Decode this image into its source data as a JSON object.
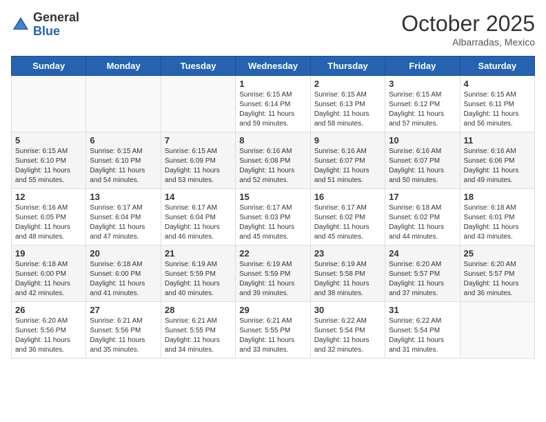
{
  "header": {
    "logo_general": "General",
    "logo_blue": "Blue",
    "month_title": "October 2025",
    "location": "Albarradas, Mexico"
  },
  "weekdays": [
    "Sunday",
    "Monday",
    "Tuesday",
    "Wednesday",
    "Thursday",
    "Friday",
    "Saturday"
  ],
  "weeks": [
    [
      {
        "day": "",
        "info": ""
      },
      {
        "day": "",
        "info": ""
      },
      {
        "day": "",
        "info": ""
      },
      {
        "day": "1",
        "info": "Sunrise: 6:15 AM\nSunset: 6:14 PM\nDaylight: 11 hours\nand 59 minutes."
      },
      {
        "day": "2",
        "info": "Sunrise: 6:15 AM\nSunset: 6:13 PM\nDaylight: 11 hours\nand 58 minutes."
      },
      {
        "day": "3",
        "info": "Sunrise: 6:15 AM\nSunset: 6:12 PM\nDaylight: 11 hours\nand 57 minutes."
      },
      {
        "day": "4",
        "info": "Sunrise: 6:15 AM\nSunset: 6:11 PM\nDaylight: 11 hours\nand 56 minutes."
      }
    ],
    [
      {
        "day": "5",
        "info": "Sunrise: 6:15 AM\nSunset: 6:10 PM\nDaylight: 11 hours\nand 55 minutes."
      },
      {
        "day": "6",
        "info": "Sunrise: 6:15 AM\nSunset: 6:10 PM\nDaylight: 11 hours\nand 54 minutes."
      },
      {
        "day": "7",
        "info": "Sunrise: 6:15 AM\nSunset: 6:09 PM\nDaylight: 11 hours\nand 53 minutes."
      },
      {
        "day": "8",
        "info": "Sunrise: 6:16 AM\nSunset: 6:08 PM\nDaylight: 11 hours\nand 52 minutes."
      },
      {
        "day": "9",
        "info": "Sunrise: 6:16 AM\nSunset: 6:07 PM\nDaylight: 11 hours\nand 51 minutes."
      },
      {
        "day": "10",
        "info": "Sunrise: 6:16 AM\nSunset: 6:07 PM\nDaylight: 11 hours\nand 50 minutes."
      },
      {
        "day": "11",
        "info": "Sunrise: 6:16 AM\nSunset: 6:06 PM\nDaylight: 11 hours\nand 49 minutes."
      }
    ],
    [
      {
        "day": "12",
        "info": "Sunrise: 6:16 AM\nSunset: 6:05 PM\nDaylight: 11 hours\nand 48 minutes."
      },
      {
        "day": "13",
        "info": "Sunrise: 6:17 AM\nSunset: 6:04 PM\nDaylight: 11 hours\nand 47 minutes."
      },
      {
        "day": "14",
        "info": "Sunrise: 6:17 AM\nSunset: 6:04 PM\nDaylight: 11 hours\nand 46 minutes."
      },
      {
        "day": "15",
        "info": "Sunrise: 6:17 AM\nSunset: 6:03 PM\nDaylight: 11 hours\nand 45 minutes."
      },
      {
        "day": "16",
        "info": "Sunrise: 6:17 AM\nSunset: 6:02 PM\nDaylight: 11 hours\nand 45 minutes."
      },
      {
        "day": "17",
        "info": "Sunrise: 6:18 AM\nSunset: 6:02 PM\nDaylight: 11 hours\nand 44 minutes."
      },
      {
        "day": "18",
        "info": "Sunrise: 6:18 AM\nSunset: 6:01 PM\nDaylight: 11 hours\nand 43 minutes."
      }
    ],
    [
      {
        "day": "19",
        "info": "Sunrise: 6:18 AM\nSunset: 6:00 PM\nDaylight: 11 hours\nand 42 minutes."
      },
      {
        "day": "20",
        "info": "Sunrise: 6:18 AM\nSunset: 6:00 PM\nDaylight: 11 hours\nand 41 minutes."
      },
      {
        "day": "21",
        "info": "Sunrise: 6:19 AM\nSunset: 5:59 PM\nDaylight: 11 hours\nand 40 minutes."
      },
      {
        "day": "22",
        "info": "Sunrise: 6:19 AM\nSunset: 5:59 PM\nDaylight: 11 hours\nand 39 minutes."
      },
      {
        "day": "23",
        "info": "Sunrise: 6:19 AM\nSunset: 5:58 PM\nDaylight: 11 hours\nand 38 minutes."
      },
      {
        "day": "24",
        "info": "Sunrise: 6:20 AM\nSunset: 5:57 PM\nDaylight: 11 hours\nand 37 minutes."
      },
      {
        "day": "25",
        "info": "Sunrise: 6:20 AM\nSunset: 5:57 PM\nDaylight: 11 hours\nand 36 minutes."
      }
    ],
    [
      {
        "day": "26",
        "info": "Sunrise: 6:20 AM\nSunset: 5:56 PM\nDaylight: 11 hours\nand 36 minutes."
      },
      {
        "day": "27",
        "info": "Sunrise: 6:21 AM\nSunset: 5:56 PM\nDaylight: 11 hours\nand 35 minutes."
      },
      {
        "day": "28",
        "info": "Sunrise: 6:21 AM\nSunset: 5:55 PM\nDaylight: 11 hours\nand 34 minutes."
      },
      {
        "day": "29",
        "info": "Sunrise: 6:21 AM\nSunset: 5:55 PM\nDaylight: 11 hours\nand 33 minutes."
      },
      {
        "day": "30",
        "info": "Sunrise: 6:22 AM\nSunset: 5:54 PM\nDaylight: 11 hours\nand 32 minutes."
      },
      {
        "day": "31",
        "info": "Sunrise: 6:22 AM\nSunset: 5:54 PM\nDaylight: 11 hours\nand 31 minutes."
      },
      {
        "day": "",
        "info": ""
      }
    ]
  ]
}
